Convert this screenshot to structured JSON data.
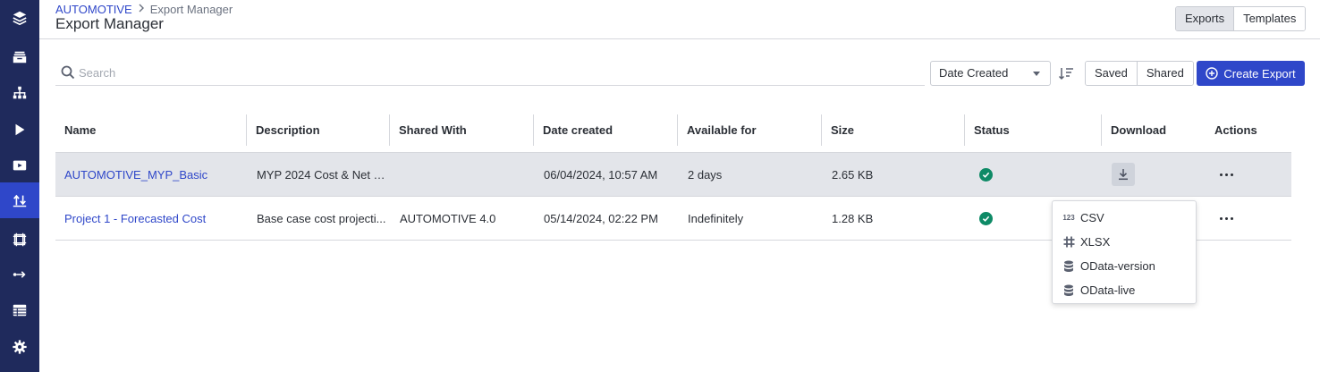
{
  "sidebar": {
    "items": [
      {
        "icon": "layers-icon"
      },
      {
        "icon": "inbox-icon"
      },
      {
        "icon": "hierarchy-icon"
      },
      {
        "icon": "play-icon"
      },
      {
        "icon": "video-icon"
      },
      {
        "icon": "export-arrows-icon",
        "active": true
      },
      {
        "icon": "frame-icon"
      },
      {
        "icon": "route-icon"
      },
      {
        "icon": "table-icon"
      },
      {
        "icon": "gear-icon"
      }
    ]
  },
  "breadcrumb": {
    "root": "AUTOMOTIVE",
    "current": "Export Manager"
  },
  "page_title": "Export Manager",
  "view_toggle": {
    "exports": "Exports",
    "templates": "Templates",
    "selected": "Exports"
  },
  "search": {
    "placeholder": "Search",
    "value": ""
  },
  "sort_select": {
    "value": "Date Created"
  },
  "filter_toggle": {
    "saved": "Saved",
    "shared": "Shared"
  },
  "create_button": {
    "label": "Create Export"
  },
  "table": {
    "columns": [
      "Name",
      "Description",
      "Shared With",
      "Date created",
      "Available for",
      "Size",
      "Status",
      "Download",
      "Actions"
    ],
    "rows": [
      {
        "name": "AUTOMOTIVE_MYP_Basic",
        "description": "MYP 2024 Cost & Net P...",
        "shared_with": "",
        "date_created": "06/04/2024, 10:57 AM",
        "available_for": "2 days",
        "size": "2.65 KB",
        "status": "success"
      },
      {
        "name": "Project 1 - Forecasted Cost",
        "description": "Base case cost projecti...",
        "shared_with": "AUTOMOTIVE 4.0",
        "date_created": "05/14/2024, 02:22 PM",
        "available_for": "Indefinitely",
        "size": "1.28 KB",
        "status": "success"
      }
    ]
  },
  "download_menu": {
    "items": [
      {
        "label": "CSV",
        "icon": "123"
      },
      {
        "label": "XLSX",
        "icon": "grid-icon"
      },
      {
        "label": "OData-version",
        "icon": "database-icon"
      },
      {
        "label": "OData-live",
        "icon": "database-icon"
      }
    ]
  },
  "colors": {
    "sidebar": "#1f2a5c",
    "accent": "#2f47c9",
    "success": "#0e8a66",
    "row_highlight": "#e3e5ea"
  }
}
